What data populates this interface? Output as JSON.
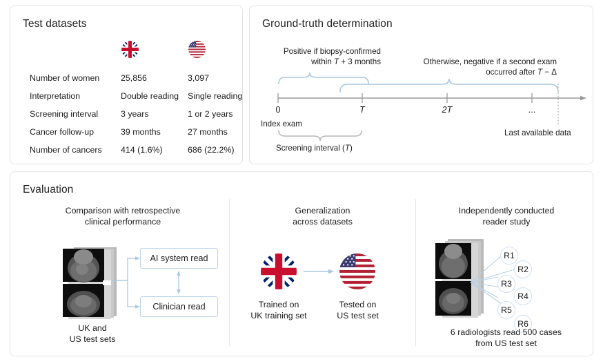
{
  "panels": {
    "datasets": {
      "title": "Test datasets"
    },
    "truth": {
      "title": "Ground-truth determination"
    },
    "evaluation": {
      "title": "Evaluation"
    }
  },
  "datasets_table": {
    "columns": [
      {
        "key": "label",
        "header": ""
      },
      {
        "key": "uk",
        "header": "uk-flag-icon"
      },
      {
        "key": "us",
        "header": "us-flag-icon"
      }
    ],
    "rows": [
      {
        "label": "Number of women",
        "uk": "25,856",
        "us": "3,097"
      },
      {
        "label": "Interpretation",
        "uk": "Double reading",
        "us": "Single reading"
      },
      {
        "label": "Screening interval",
        "uk": "3 years",
        "us": "1 or 2 years"
      },
      {
        "label": "Cancer follow-up",
        "uk": "39 months",
        "us": "27 months"
      },
      {
        "label": "Number of cancers",
        "uk": "414 (1.6%)",
        "us": "686 (22.2%)"
      }
    ]
  },
  "timeline": {
    "positive_rule_line1": "Positive if biopsy-confirmed",
    "positive_rule_line2_pre": "within ",
    "positive_rule_line2_var": "T",
    "positive_rule_line2_post": " + 3 months",
    "negative_rule_line1": "Otherwise, negative if a second exam",
    "negative_rule_line2_pre": "occurred after ",
    "negative_rule_line2_var": "T",
    "negative_rule_line2_post": " − Δ",
    "ticks": [
      {
        "label": "0",
        "italic": false
      },
      {
        "label": "T",
        "italic": true
      },
      {
        "label": "2T",
        "italic": true
      },
      {
        "label": "...",
        "italic": false
      }
    ],
    "index_exam_label": "Index exam",
    "last_data_label": "Last available data",
    "screening_interval_pre": "Screening interval (",
    "screening_interval_var": "T",
    "screening_interval_post": ")"
  },
  "evaluation": {
    "sections": [
      {
        "title_line1": "Comparison with retrospective",
        "title_line2": "clinical performance",
        "box_ai": "AI system read",
        "box_clinician": "Clinician read",
        "caption_line1": "UK and",
        "caption_line2": "US test sets"
      },
      {
        "title_line1": "Generalization",
        "title_line2": "across datasets",
        "left_caption_line1": "Trained on",
        "left_caption_line2": "UK training set",
        "right_caption_line1": "Tested on",
        "right_caption_line2": "US test set"
      },
      {
        "title_line1": "Independently conducted",
        "title_line2": "reader study",
        "readers": [
          "R1",
          "R2",
          "R3",
          "R4",
          "R5",
          "R6"
        ],
        "caption_line1": "6 radiologists read 500 cases",
        "caption_line2": "from US test set"
      }
    ]
  },
  "colors": {
    "panel_border": "#e3e3e3",
    "accent_blue": "#a8c8e4",
    "axis_gray": "#9a9a9a",
    "uk_flag_red": "#c8102e",
    "uk_flag_blue": "#012169",
    "us_flag_red": "#b22234",
    "us_flag_blue": "#3c3b6e"
  }
}
